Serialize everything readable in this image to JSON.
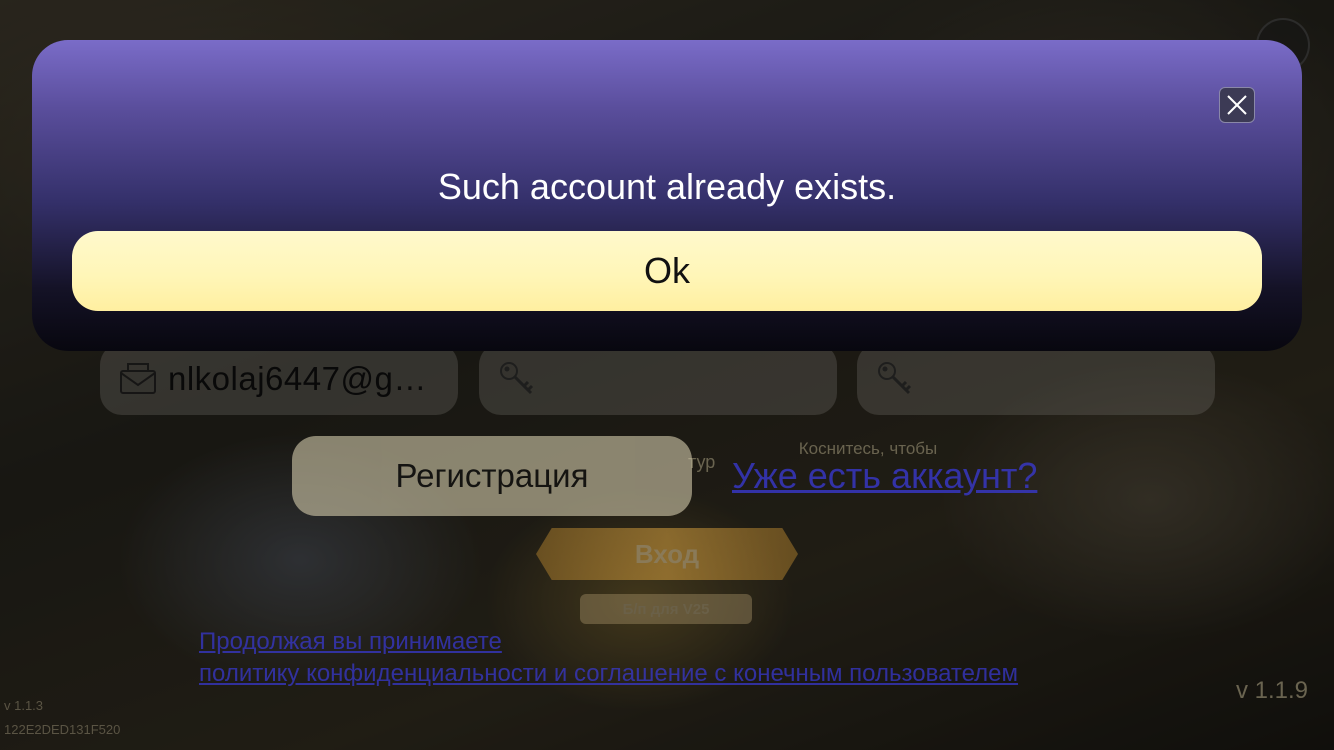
{
  "modal": {
    "message": "Such account already exists.",
    "ok_label": "Ok"
  },
  "form": {
    "email_value": "nlkolaj6447@g…",
    "password_value": "",
    "confirm_password_value": "",
    "register_label": "Регистрация",
    "have_account_link": "Уже есть аккаунт?",
    "ghost_text": "тур",
    "touch_hint": "Коснитесь, чтобы",
    "login_label": "Вход",
    "free_tag": "Б/п для V25"
  },
  "policy": {
    "line1": "Продолжая вы принимаете",
    "line2": "политику конфиденциальности и соглашение с конечным пользователем"
  },
  "footer": {
    "version_right": "v 1.1.9",
    "version_left": "v 1.1.3",
    "build_id": "122E2DED131F520"
  },
  "icons": {
    "email": "envelope-icon",
    "password": "key-icon",
    "confirm": "key-icon",
    "modal_close": "close-icon"
  },
  "colors": {
    "modal_top": "#7a6cc8",
    "modal_bottom": "#08070f",
    "ok_button": "#fff6b8",
    "link": "#3a3ad8"
  }
}
